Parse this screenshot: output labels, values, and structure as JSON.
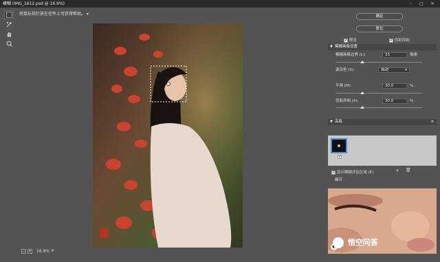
{
  "window": {
    "title": "模糊 (IMG_1612.psd @ 16.9%)",
    "minimize": "–",
    "restore": "□",
    "close": "✕"
  },
  "hint": {
    "text": "将鼠标指针放在控件上可获得帮助。"
  },
  "tools": [
    "marquee-icon",
    "warp-icon",
    "hand-icon",
    "zoom-icon"
  ],
  "status": {
    "zoom": "16.9%",
    "zoom_out": "−",
    "zoom_in": "+"
  },
  "panel": {
    "ok": "确定",
    "reset": "复位",
    "preview_label": "预览",
    "pseudo_noise_label": "伪影抑制",
    "blur_section": "模糊画像设置",
    "fields": [
      {
        "label": "模糊画像边界 (L):",
        "value": "33",
        "unit": "像素",
        "slider": 0.3
      },
      {
        "label": "源杂色 (S):",
        "value": "自动",
        "unit": "",
        "slider": null
      },
      {
        "label": "平滑 (M):",
        "value": "30.0",
        "unit": "%",
        "slider": 0.3
      },
      {
        "label": "伪影抑制 (A):",
        "value": "30.0",
        "unit": "%",
        "slider": 0.3
      }
    ],
    "advanced_section": "高级",
    "add_icon": "+",
    "show_blur_label": "显示模糊评估区域 (E)",
    "detail_section": "细节"
  },
  "watermark": {
    "text": "悟空问答"
  },
  "colors": {
    "accent": "#4a90d9",
    "background": "#535353",
    "titlebar": "#2b2b2b"
  }
}
